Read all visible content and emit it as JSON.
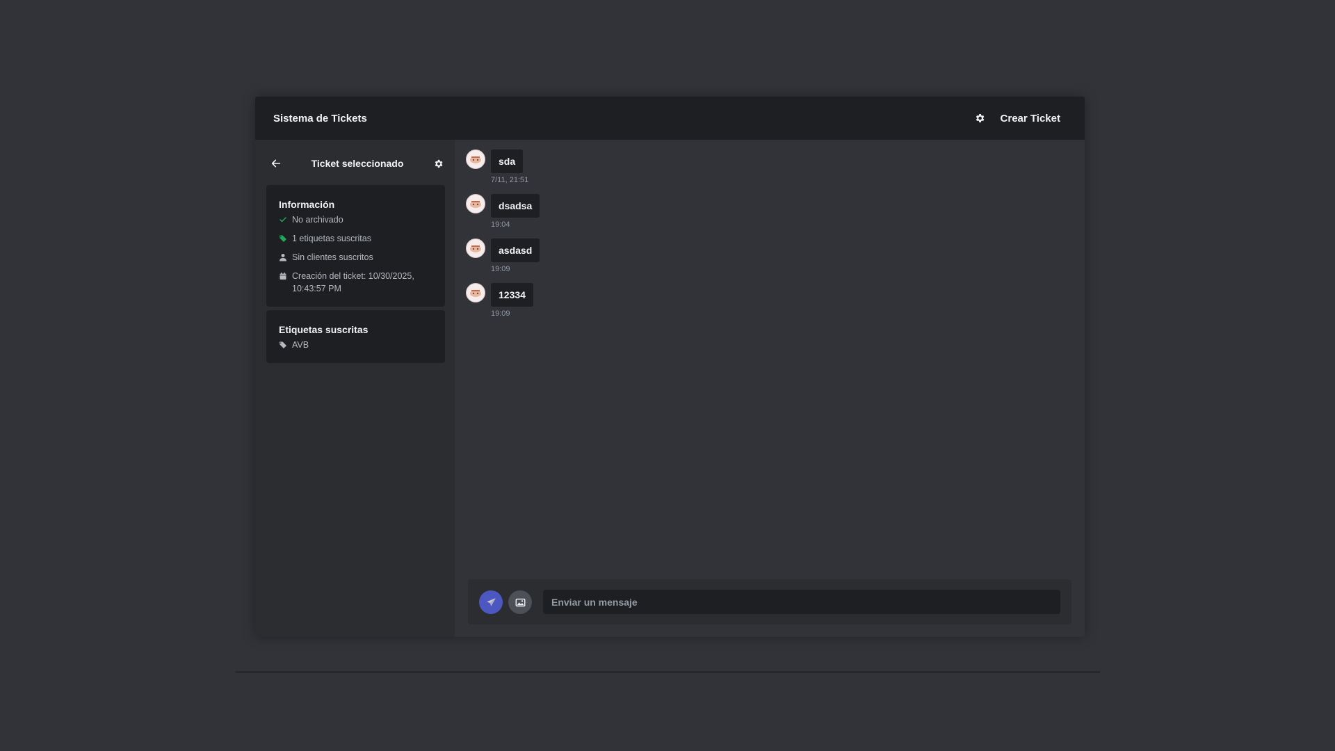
{
  "header": {
    "title": "Sistema de Tickets",
    "create_label": "Crear Ticket"
  },
  "sidebar": {
    "title": "Ticket seleccionado",
    "info": {
      "title": "Información",
      "archived": "No archivado",
      "tags_count": "1 etiquetas suscritas",
      "clients": "Sin clientes suscritos",
      "created": "Creación del ticket: 10/30/2025, 10:43:57 PM"
    },
    "tags": {
      "title": "Etiquetas suscritas",
      "items": [
        "AVB"
      ]
    }
  },
  "messages": [
    {
      "text": "sda",
      "time": "7/11, 21:51"
    },
    {
      "text": "dsadsa",
      "time": "19:04"
    },
    {
      "text": "asdasd",
      "time": "19:09"
    },
    {
      "text": "12334",
      "time": "19:09"
    }
  ],
  "composer": {
    "placeholder": "Enviar un mensaje"
  },
  "colors": {
    "accent": "#5865f2",
    "success": "#23a55a",
    "background": "#313338",
    "panel": "#1e1f22"
  }
}
